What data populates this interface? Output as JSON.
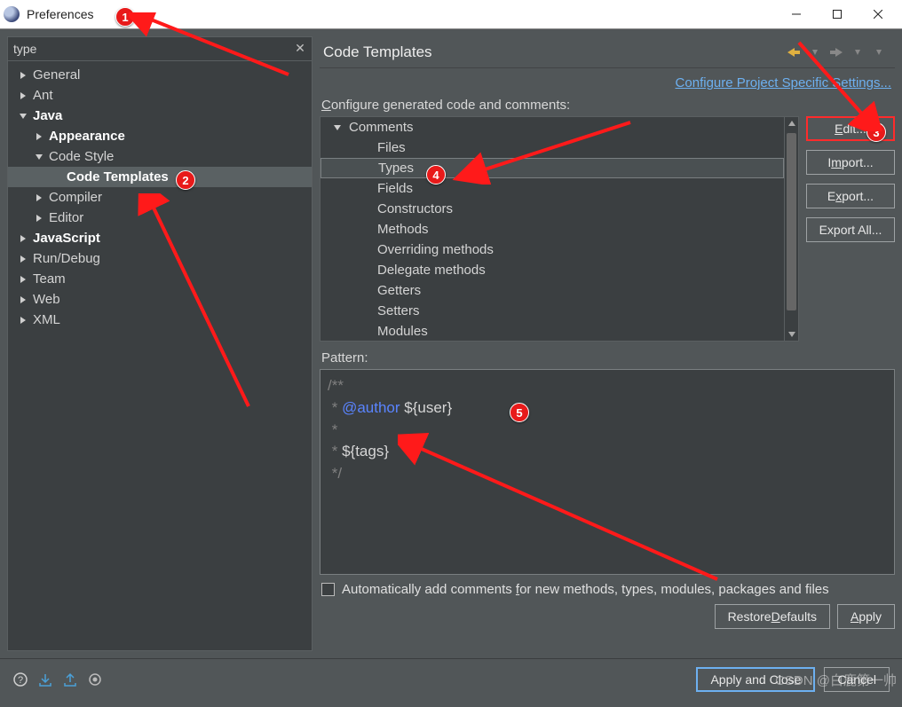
{
  "window": {
    "title": "Preferences"
  },
  "search": {
    "value": "type"
  },
  "tree": [
    {
      "label": "General",
      "indent": 0,
      "expand": "right",
      "bold": false
    },
    {
      "label": "Ant",
      "indent": 0,
      "expand": "right",
      "bold": false
    },
    {
      "label": "Java",
      "indent": 0,
      "expand": "down",
      "bold": true
    },
    {
      "label": "Appearance",
      "indent": 1,
      "expand": "right",
      "bold": true
    },
    {
      "label": "Code Style",
      "indent": 1,
      "expand": "down",
      "bold": false
    },
    {
      "label": "Code Templates",
      "indent": 2,
      "expand": "none",
      "bold": true,
      "selected": true
    },
    {
      "label": "Compiler",
      "indent": 1,
      "expand": "right",
      "bold": false
    },
    {
      "label": "Editor",
      "indent": 1,
      "expand": "right",
      "bold": false
    },
    {
      "label": "JavaScript",
      "indent": 0,
      "expand": "right",
      "bold": true
    },
    {
      "label": "Run/Debug",
      "indent": 0,
      "expand": "right",
      "bold": false
    },
    {
      "label": "Team",
      "indent": 0,
      "expand": "right",
      "bold": false
    },
    {
      "label": "Web",
      "indent": 0,
      "expand": "right",
      "bold": false
    },
    {
      "label": "XML",
      "indent": 0,
      "expand": "right",
      "bold": false
    }
  ],
  "right": {
    "heading": "Code Templates",
    "link": "Configure Project Specific Settings...",
    "section_configure": "Configure generated code and comments:",
    "tree_nodes": [
      {
        "label": "Comments",
        "indent": 0,
        "arrow": "down"
      },
      {
        "label": "Files",
        "indent": 1,
        "arrow": "none"
      },
      {
        "label": "Types",
        "indent": 1,
        "arrow": "none",
        "selected": true
      },
      {
        "label": "Fields",
        "indent": 1,
        "arrow": "none"
      },
      {
        "label": "Constructors",
        "indent": 1,
        "arrow": "none"
      },
      {
        "label": "Methods",
        "indent": 1,
        "arrow": "none"
      },
      {
        "label": "Overriding methods",
        "indent": 1,
        "arrow": "none"
      },
      {
        "label": "Delegate methods",
        "indent": 1,
        "arrow": "none"
      },
      {
        "label": "Getters",
        "indent": 1,
        "arrow": "none"
      },
      {
        "label": "Setters",
        "indent": 1,
        "arrow": "none"
      },
      {
        "label": "Modules",
        "indent": 1,
        "arrow": "none"
      }
    ],
    "buttons": {
      "edit": "Edit...",
      "import": "Import...",
      "export": "Export...",
      "export_all": "Export All..."
    },
    "pattern_label": "Pattern:",
    "pattern_lines": [
      {
        "text": "/**",
        "cls": ""
      },
      {
        "text": " * @author ${user}",
        "cls": "mix"
      },
      {
        "text": " *",
        "cls": ""
      },
      {
        "text": " * ${tags}",
        "cls": "var"
      },
      {
        "text": " */",
        "cls": ""
      }
    ],
    "checkbox_label": "Automatically add comments for new methods, types, modules, packages and files",
    "restore": "Restore Defaults",
    "apply": "Apply"
  },
  "footer": {
    "apply_close": "Apply and Close",
    "cancel": "Cancel"
  },
  "watermark": "CSDN @白鹿第一帅",
  "badges": {
    "b1": "1",
    "b2": "2",
    "b3": "3",
    "b4": "4",
    "b5": "5"
  }
}
